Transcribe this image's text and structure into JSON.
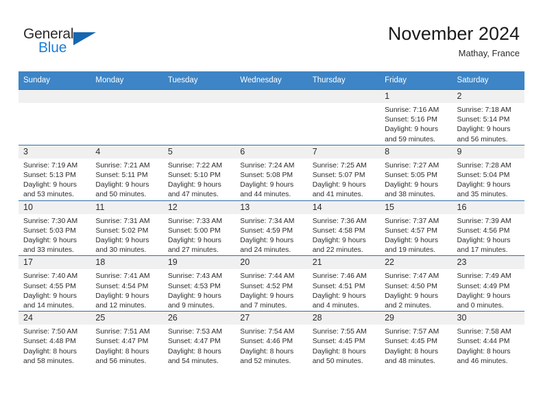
{
  "brand": {
    "name_part1": "General",
    "name_part2": "Blue",
    "triangle_icon": "triangle-icon",
    "color_dark": "#2b2b2b",
    "color_blue": "#1c7fd6"
  },
  "header": {
    "title": "November 2024",
    "subtitle": "Mathay, France"
  },
  "theme": {
    "header_row_bg": "#3d85c6",
    "daynum_bg": "#f0f0f0",
    "grid_line": "#2f6ea5",
    "text": "#2b2b2b"
  },
  "columns": [
    "Sunday",
    "Monday",
    "Tuesday",
    "Wednesday",
    "Thursday",
    "Friday",
    "Saturday"
  ],
  "weeks": [
    [
      {
        "day": "",
        "sunrise": "",
        "sunset": "",
        "daylight1": "",
        "daylight2": "",
        "empty": true
      },
      {
        "day": "",
        "sunrise": "",
        "sunset": "",
        "daylight1": "",
        "daylight2": "",
        "empty": true
      },
      {
        "day": "",
        "sunrise": "",
        "sunset": "",
        "daylight1": "",
        "daylight2": "",
        "empty": true
      },
      {
        "day": "",
        "sunrise": "",
        "sunset": "",
        "daylight1": "",
        "daylight2": "",
        "empty": true
      },
      {
        "day": "",
        "sunrise": "",
        "sunset": "",
        "daylight1": "",
        "daylight2": "",
        "empty": true
      },
      {
        "day": "1",
        "sunrise": "Sunrise: 7:16 AM",
        "sunset": "Sunset: 5:16 PM",
        "daylight1": "Daylight: 9 hours",
        "daylight2": "and 59 minutes.",
        "empty": false
      },
      {
        "day": "2",
        "sunrise": "Sunrise: 7:18 AM",
        "sunset": "Sunset: 5:14 PM",
        "daylight1": "Daylight: 9 hours",
        "daylight2": "and 56 minutes.",
        "empty": false
      }
    ],
    [
      {
        "day": "3",
        "sunrise": "Sunrise: 7:19 AM",
        "sunset": "Sunset: 5:13 PM",
        "daylight1": "Daylight: 9 hours",
        "daylight2": "and 53 minutes.",
        "empty": false
      },
      {
        "day": "4",
        "sunrise": "Sunrise: 7:21 AM",
        "sunset": "Sunset: 5:11 PM",
        "daylight1": "Daylight: 9 hours",
        "daylight2": "and 50 minutes.",
        "empty": false
      },
      {
        "day": "5",
        "sunrise": "Sunrise: 7:22 AM",
        "sunset": "Sunset: 5:10 PM",
        "daylight1": "Daylight: 9 hours",
        "daylight2": "and 47 minutes.",
        "empty": false
      },
      {
        "day": "6",
        "sunrise": "Sunrise: 7:24 AM",
        "sunset": "Sunset: 5:08 PM",
        "daylight1": "Daylight: 9 hours",
        "daylight2": "and 44 minutes.",
        "empty": false
      },
      {
        "day": "7",
        "sunrise": "Sunrise: 7:25 AM",
        "sunset": "Sunset: 5:07 PM",
        "daylight1": "Daylight: 9 hours",
        "daylight2": "and 41 minutes.",
        "empty": false
      },
      {
        "day": "8",
        "sunrise": "Sunrise: 7:27 AM",
        "sunset": "Sunset: 5:05 PM",
        "daylight1": "Daylight: 9 hours",
        "daylight2": "and 38 minutes.",
        "empty": false
      },
      {
        "day": "9",
        "sunrise": "Sunrise: 7:28 AM",
        "sunset": "Sunset: 5:04 PM",
        "daylight1": "Daylight: 9 hours",
        "daylight2": "and 35 minutes.",
        "empty": false
      }
    ],
    [
      {
        "day": "10",
        "sunrise": "Sunrise: 7:30 AM",
        "sunset": "Sunset: 5:03 PM",
        "daylight1": "Daylight: 9 hours",
        "daylight2": "and 33 minutes.",
        "empty": false
      },
      {
        "day": "11",
        "sunrise": "Sunrise: 7:31 AM",
        "sunset": "Sunset: 5:02 PM",
        "daylight1": "Daylight: 9 hours",
        "daylight2": "and 30 minutes.",
        "empty": false
      },
      {
        "day": "12",
        "sunrise": "Sunrise: 7:33 AM",
        "sunset": "Sunset: 5:00 PM",
        "daylight1": "Daylight: 9 hours",
        "daylight2": "and 27 minutes.",
        "empty": false
      },
      {
        "day": "13",
        "sunrise": "Sunrise: 7:34 AM",
        "sunset": "Sunset: 4:59 PM",
        "daylight1": "Daylight: 9 hours",
        "daylight2": "and 24 minutes.",
        "empty": false
      },
      {
        "day": "14",
        "sunrise": "Sunrise: 7:36 AM",
        "sunset": "Sunset: 4:58 PM",
        "daylight1": "Daylight: 9 hours",
        "daylight2": "and 22 minutes.",
        "empty": false
      },
      {
        "day": "15",
        "sunrise": "Sunrise: 7:37 AM",
        "sunset": "Sunset: 4:57 PM",
        "daylight1": "Daylight: 9 hours",
        "daylight2": "and 19 minutes.",
        "empty": false
      },
      {
        "day": "16",
        "sunrise": "Sunrise: 7:39 AM",
        "sunset": "Sunset: 4:56 PM",
        "daylight1": "Daylight: 9 hours",
        "daylight2": "and 17 minutes.",
        "empty": false
      }
    ],
    [
      {
        "day": "17",
        "sunrise": "Sunrise: 7:40 AM",
        "sunset": "Sunset: 4:55 PM",
        "daylight1": "Daylight: 9 hours",
        "daylight2": "and 14 minutes.",
        "empty": false
      },
      {
        "day": "18",
        "sunrise": "Sunrise: 7:41 AM",
        "sunset": "Sunset: 4:54 PM",
        "daylight1": "Daylight: 9 hours",
        "daylight2": "and 12 minutes.",
        "empty": false
      },
      {
        "day": "19",
        "sunrise": "Sunrise: 7:43 AM",
        "sunset": "Sunset: 4:53 PM",
        "daylight1": "Daylight: 9 hours",
        "daylight2": "and 9 minutes.",
        "empty": false
      },
      {
        "day": "20",
        "sunrise": "Sunrise: 7:44 AM",
        "sunset": "Sunset: 4:52 PM",
        "daylight1": "Daylight: 9 hours",
        "daylight2": "and 7 minutes.",
        "empty": false
      },
      {
        "day": "21",
        "sunrise": "Sunrise: 7:46 AM",
        "sunset": "Sunset: 4:51 PM",
        "daylight1": "Daylight: 9 hours",
        "daylight2": "and 4 minutes.",
        "empty": false
      },
      {
        "day": "22",
        "sunrise": "Sunrise: 7:47 AM",
        "sunset": "Sunset: 4:50 PM",
        "daylight1": "Daylight: 9 hours",
        "daylight2": "and 2 minutes.",
        "empty": false
      },
      {
        "day": "23",
        "sunrise": "Sunrise: 7:49 AM",
        "sunset": "Sunset: 4:49 PM",
        "daylight1": "Daylight: 9 hours",
        "daylight2": "and 0 minutes.",
        "empty": false
      }
    ],
    [
      {
        "day": "24",
        "sunrise": "Sunrise: 7:50 AM",
        "sunset": "Sunset: 4:48 PM",
        "daylight1": "Daylight: 8 hours",
        "daylight2": "and 58 minutes.",
        "empty": false
      },
      {
        "day": "25",
        "sunrise": "Sunrise: 7:51 AM",
        "sunset": "Sunset: 4:47 PM",
        "daylight1": "Daylight: 8 hours",
        "daylight2": "and 56 minutes.",
        "empty": false
      },
      {
        "day": "26",
        "sunrise": "Sunrise: 7:53 AM",
        "sunset": "Sunset: 4:47 PM",
        "daylight1": "Daylight: 8 hours",
        "daylight2": "and 54 minutes.",
        "empty": false
      },
      {
        "day": "27",
        "sunrise": "Sunrise: 7:54 AM",
        "sunset": "Sunset: 4:46 PM",
        "daylight1": "Daylight: 8 hours",
        "daylight2": "and 52 minutes.",
        "empty": false
      },
      {
        "day": "28",
        "sunrise": "Sunrise: 7:55 AM",
        "sunset": "Sunset: 4:45 PM",
        "daylight1": "Daylight: 8 hours",
        "daylight2": "and 50 minutes.",
        "empty": false
      },
      {
        "day": "29",
        "sunrise": "Sunrise: 7:57 AM",
        "sunset": "Sunset: 4:45 PM",
        "daylight1": "Daylight: 8 hours",
        "daylight2": "and 48 minutes.",
        "empty": false
      },
      {
        "day": "30",
        "sunrise": "Sunrise: 7:58 AM",
        "sunset": "Sunset: 4:44 PM",
        "daylight1": "Daylight: 8 hours",
        "daylight2": "and 46 minutes.",
        "empty": false
      }
    ]
  ]
}
